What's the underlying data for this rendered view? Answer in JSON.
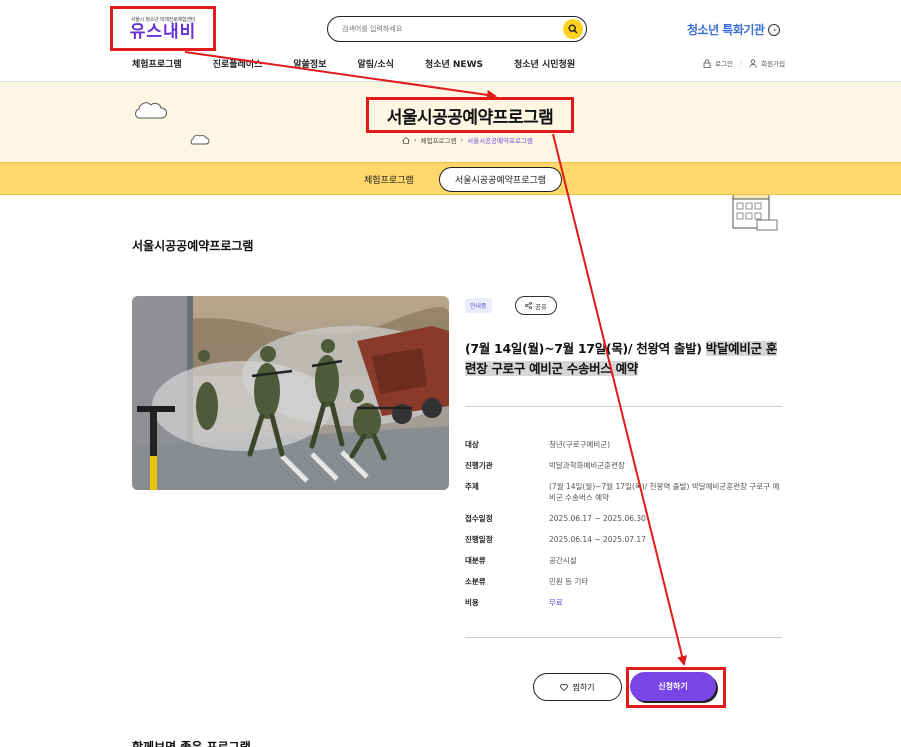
{
  "header": {
    "logo_tagline": "서울시 청소년 미래진로체험센터",
    "logo_name": "유스내비",
    "search_placeholder": "검색어를 입력하세요",
    "special_label": "청소년 특화기관",
    "nav": [
      "체험프로그램",
      "진로플레이스",
      "알쓸정보",
      "알림/소식",
      "청소년 NEWS",
      "청소년 시민청원"
    ],
    "login": "로그인",
    "join": "회원가입"
  },
  "banner": {
    "title": "서울시공공예약프로그램",
    "breadcrumb_parent": "체험프로그램",
    "breadcrumb_current": "서울시공공예약프로그램"
  },
  "tabs": {
    "tab1": "체험프로그램",
    "tab2": "서울시공공예약프로그램"
  },
  "main": {
    "section_title": "서울시공공예약프로그램",
    "status_badge": "안내중",
    "share_label": "공유",
    "title_part1": "(7월 14일(월)~7월 17일(목)/ 천왕역 출발) ",
    "title_part2": "박달예비군 훈련장 구로구 예비군 수송버스 예약",
    "info": [
      {
        "label": "대상",
        "value": "청년(구로구예비군)"
      },
      {
        "label": "진행기관",
        "value": "박달과학화예비군훈련장"
      },
      {
        "label": "주제",
        "value": "(7월 14일(월)~7월 17일(목)/ 천왕역 출발) 박달예비군훈련장 구로구 예비군 수송버스 예약"
      },
      {
        "label": "접수일정",
        "value": "2025.06.17 ~ 2025.06.30"
      },
      {
        "label": "진행일정",
        "value": "2025.06.14 ~ 2025.07.17"
      },
      {
        "label": "대분류",
        "value": "공간시설"
      },
      {
        "label": "소분류",
        "value": "민원 등 기타"
      },
      {
        "label": "비용",
        "value": "무료"
      }
    ],
    "wish_label": "찜하기",
    "apply_label": "신청하기",
    "bottom_title": "함께보면 좋은 프로그램"
  },
  "colors": {
    "accent_purple": "#7a45e6",
    "banner_bg": "#fdf6e3",
    "tab_yellow": "#ffd76a",
    "annotation_red": "#e21b1b"
  }
}
